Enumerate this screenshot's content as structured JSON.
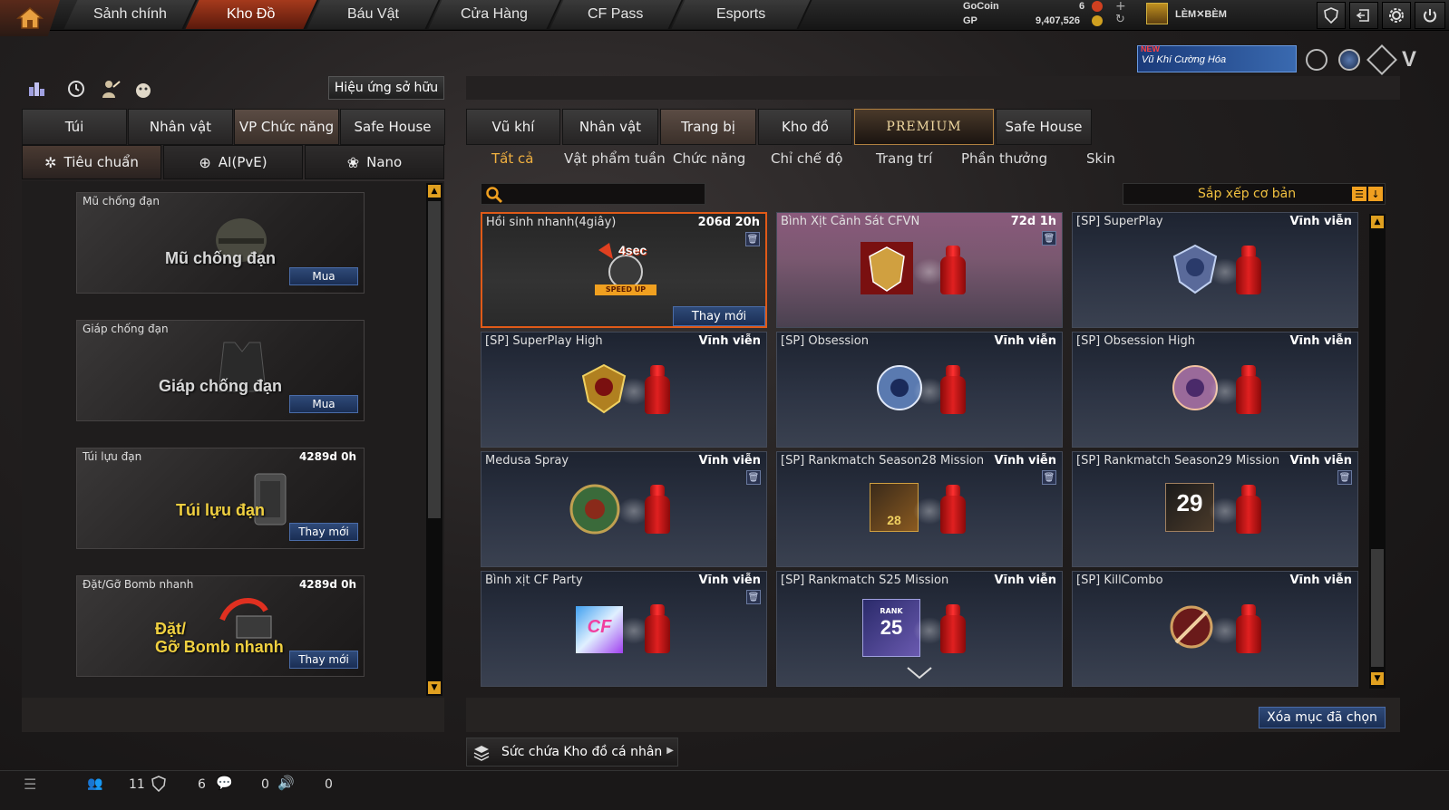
{
  "nav": {
    "tabs": [
      "Sảnh chính",
      "Kho Đồ",
      "Báu Vật",
      "Cửa Hàng",
      "CF Pass",
      "Esports"
    ],
    "active_tab": "Kho Đồ"
  },
  "currency": {
    "gocoin_label": "GoCoin",
    "gocoin_value": "6",
    "gp_label": "GP",
    "gp_value": "9,407,526",
    "player_name": "LÈM✕BÈM"
  },
  "promo": {
    "badge": "NEW",
    "text": "Vũ Khí Cường Hóa"
  },
  "left": {
    "effect_button": "Hiệu ứng sở hữu",
    "tabs": [
      "Túi",
      "Nhân vật",
      "VP Chức năng",
      "Safe House"
    ],
    "active_tab": "VP Chức năng",
    "sub_tabs": [
      "Tiêu chuẩn",
      "AI(PvE)",
      "Nano"
    ],
    "items": [
      {
        "title": "Mũ chống đạn",
        "art_text": "Mũ chống đạn",
        "time": "",
        "button": "Mua"
      },
      {
        "title": "Giáp chống đạn",
        "art_text": "Giáp chống đạn",
        "time": "",
        "button": "Mua"
      },
      {
        "title": "Túi lựu đạn",
        "art_text": "Túi lựu đạn",
        "time": "4289d 0h",
        "button": "Thay mới"
      },
      {
        "title": "Đặt/Gỡ Bomb nhanh",
        "art_text_1": "Đặt/",
        "art_text_2": "Gỡ Bomb nhanh",
        "time": "4289d 0h",
        "button": "Thay mới"
      }
    ]
  },
  "right": {
    "tabs": [
      "Vũ khí",
      "Nhân vật",
      "Trang bị",
      "Kho đồ",
      "PREMIUM",
      "Safe House"
    ],
    "active_tab": "Trang bị",
    "filters": [
      "Tất cả",
      "Vật phẩm tuần",
      "Chức năng",
      "Chỉ chế độ",
      "Trang trí",
      "Phần thưởng",
      "Skin"
    ],
    "active_filter": "Tất cả",
    "search_placeholder": "",
    "sort_label": "Sắp xếp cơ bản",
    "items": [
      {
        "name": "Hồi sinh nhanh(4giây)",
        "time": "206d 20h",
        "button": "Thay mới",
        "badge": "4sec",
        "badge_sub": "SPEED UP"
      },
      {
        "name": "Bình Xịt Cảnh Sát CFVN",
        "time": "72d 1h"
      },
      {
        "name": "[SP] SuperPlay",
        "time": "Vĩnh viễn"
      },
      {
        "name": "[SP] SuperPlay High",
        "time": "Vĩnh viễn"
      },
      {
        "name": "[SP] Obsession",
        "time": "Vĩnh viễn"
      },
      {
        "name": "[SP] Obsession High",
        "time": "Vĩnh viễn"
      },
      {
        "name": "Medusa Spray",
        "time": "Vĩnh viễn"
      },
      {
        "name": "[SP] Rankmatch Season28 Mission",
        "time": "Vĩnh viễn",
        "badge": "28"
      },
      {
        "name": "[SP] Rankmatch Season29 Mission",
        "time": "Vĩnh viễn",
        "badge": "29"
      },
      {
        "name": "Bình xịt CF Party",
        "time": "Vĩnh viễn",
        "badge": "CF"
      },
      {
        "name": "[SP] Rankmatch S25 Mission",
        "time": "Vĩnh viễn",
        "badge": "25",
        "badge_sub": "RANK"
      },
      {
        "name": "[SP] KillCombo",
        "time": "Vĩnh viễn"
      }
    ],
    "delete_button": "Xóa mục đã chọn",
    "capacity_label": "Sức chứa Kho đồ cá nhân"
  },
  "status": {
    "friends": "11",
    "clan": "6",
    "chat": "0",
    "voice": "0"
  }
}
